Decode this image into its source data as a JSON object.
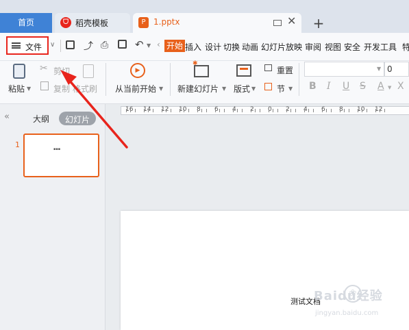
{
  "tabs": {
    "home": "首页",
    "wps_template": "稻壳模板",
    "document": "1.pptx"
  },
  "menu": {
    "file": "文件",
    "items": [
      "开始",
      "插入",
      "设计",
      "切换",
      "动画",
      "幻灯片放映",
      "审阅",
      "视图",
      "安全",
      "开发工具",
      "特"
    ]
  },
  "toolbar": {
    "paste": "粘贴",
    "cut": "剪切",
    "copy": "复制",
    "format_painter": "格式刷",
    "from_current": "从当前开始",
    "new_slide": "新建幻灯片",
    "layout": "版式",
    "reset": "重置",
    "section": "节",
    "font_size_value": "0",
    "format_buttons": [
      "B",
      "I",
      "U",
      "S",
      "A",
      "X"
    ]
  },
  "left_pane": {
    "outline_tab": "大纲",
    "slides_tab": "幻灯片",
    "slide_number": "1",
    "thumb_text": "▪▪▪"
  },
  "ruler": {
    "ticks": [
      "16",
      "14",
      "12",
      "10",
      "8",
      "6",
      "4",
      "2",
      "0",
      "2",
      "4",
      "6",
      "8",
      "10",
      "12"
    ]
  },
  "slide": {
    "text": "测试文档"
  },
  "watermark": {
    "brand": "Baidu经验",
    "url": "jingyan.baidu.com"
  },
  "colors": {
    "accent_orange": "#e8601a",
    "highlight_red": "#e8241c",
    "home_tab_blue": "#3f82d6"
  }
}
